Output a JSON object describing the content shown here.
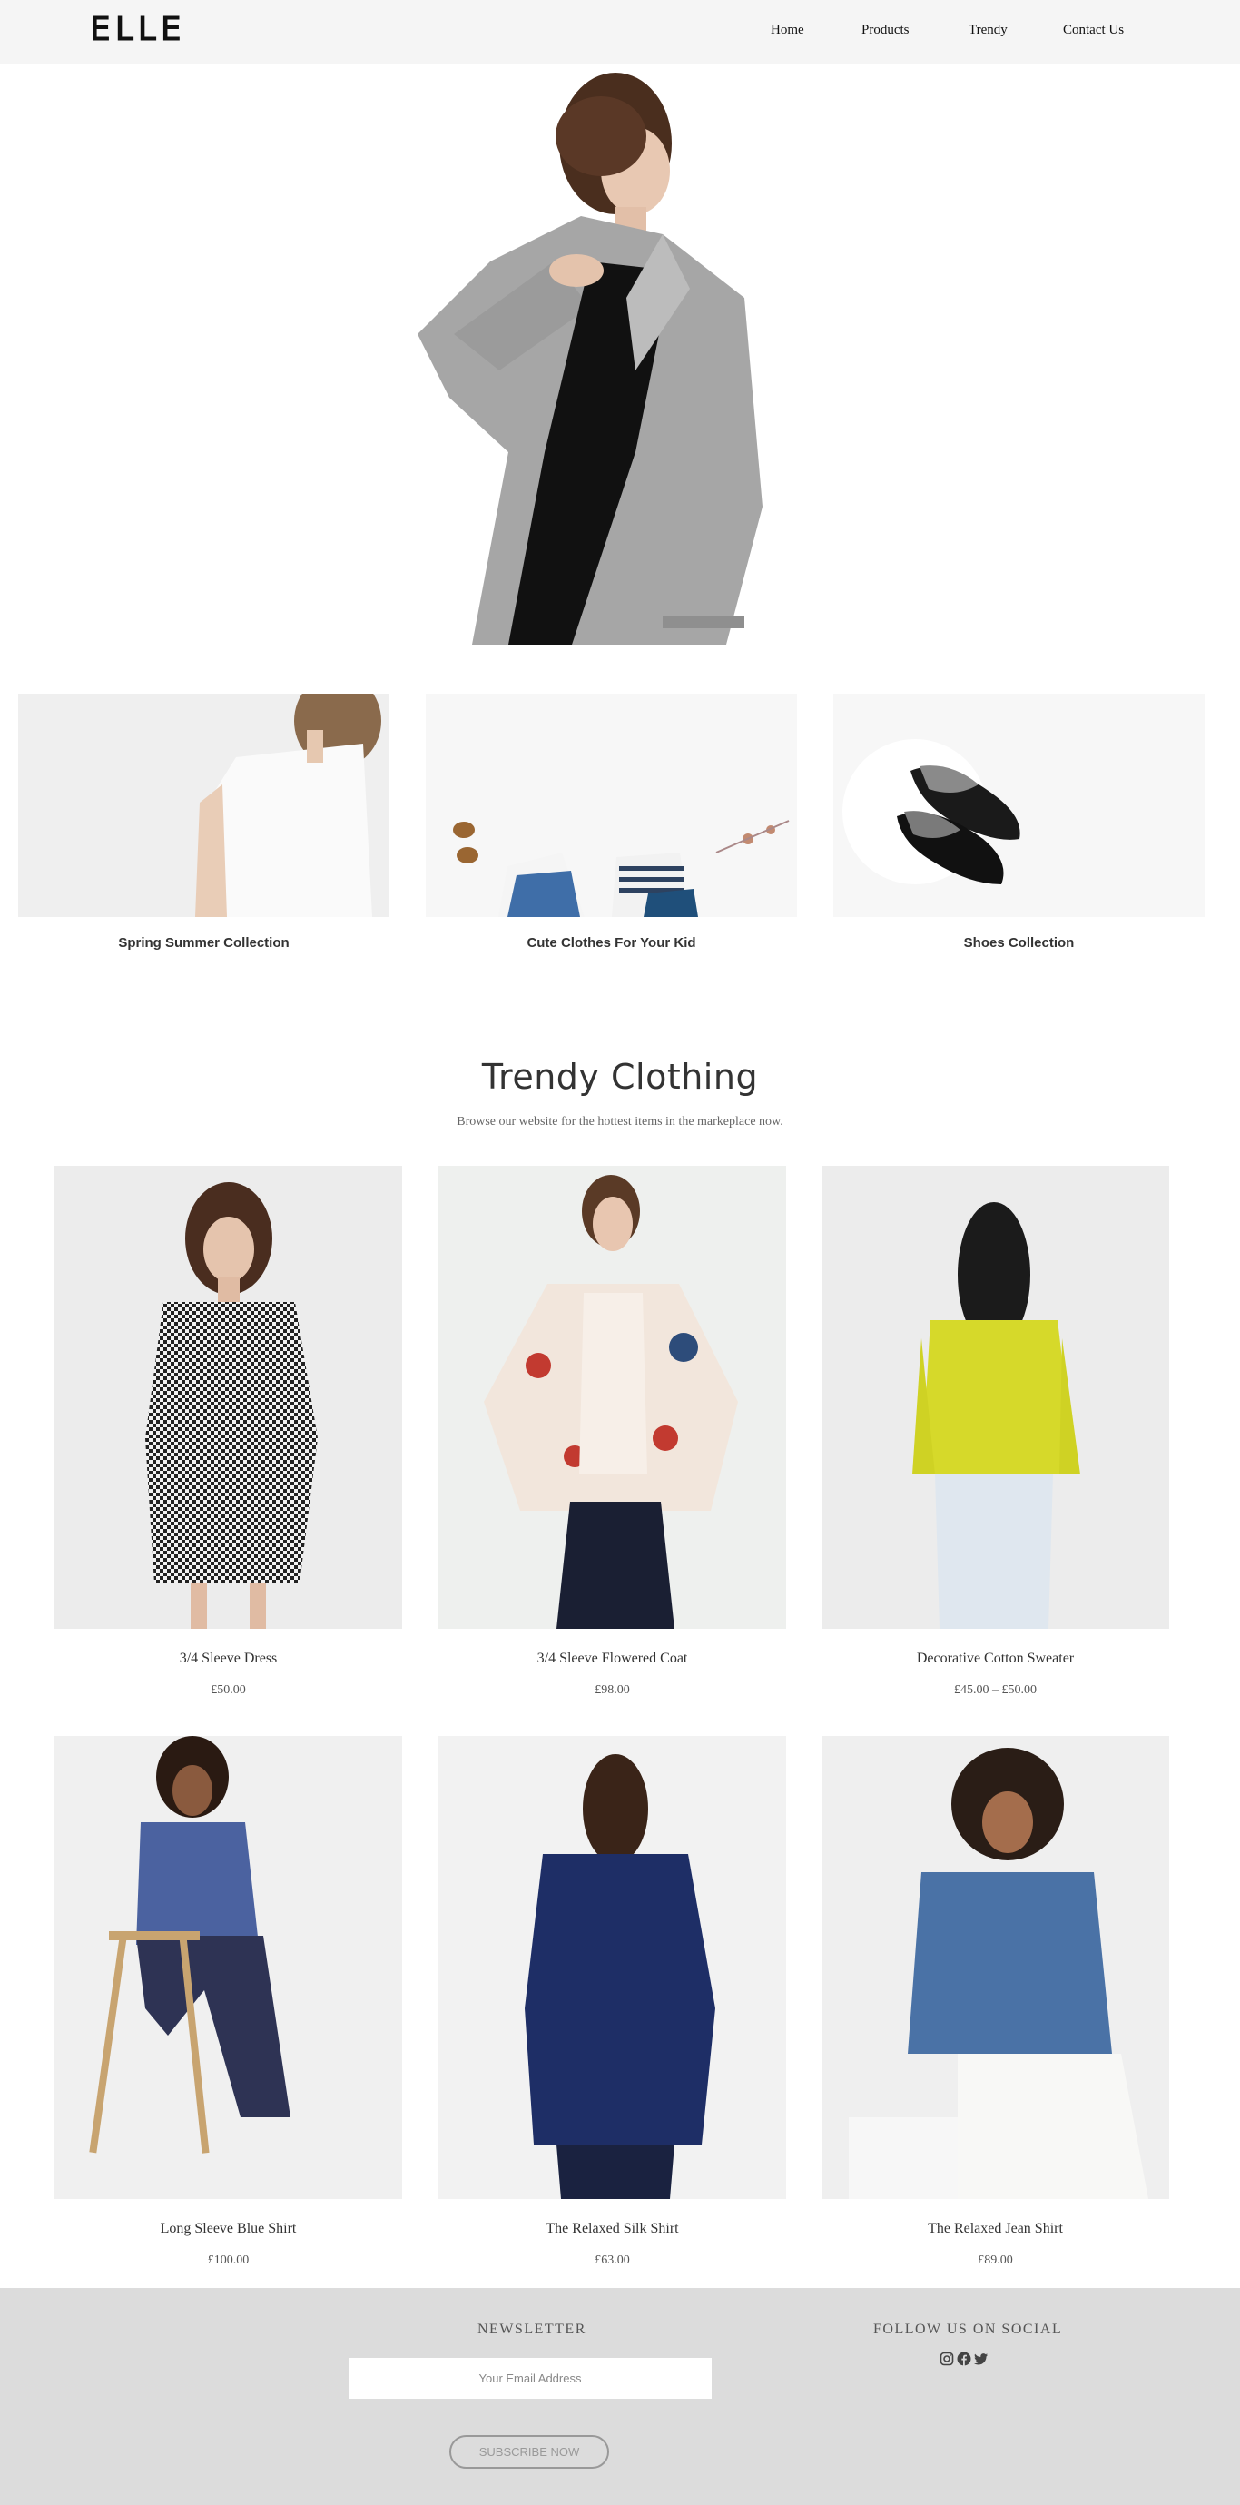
{
  "header": {
    "logo": "ELLE",
    "nav": [
      "Home",
      "Products",
      "Trendy",
      "Contact Us"
    ]
  },
  "categories": [
    {
      "label": "Spring Summer Collection"
    },
    {
      "label": "Cute Clothes For Your Kid"
    },
    {
      "label": "Shoes Collection"
    }
  ],
  "trendy": {
    "title": "Trendy Clothing",
    "subtitle": "Browse our website for the hottest items in the markeplace now."
  },
  "products": [
    {
      "name": "3/4 Sleeve Dress",
      "price": "£50.00"
    },
    {
      "name": "3/4 Sleeve Flowered Coat",
      "price": "£98.00"
    },
    {
      "name": "Decorative Cotton Sweater",
      "price": "£45.00 – £50.00"
    },
    {
      "name": "Long Sleeve Blue Shirt",
      "price": "£100.00"
    },
    {
      "name": "The Relaxed Silk Shirt",
      "price": "£63.00"
    },
    {
      "name": "The Relaxed Jean Shirt",
      "price": "£89.00"
    }
  ],
  "footer": {
    "newsletter_heading": "NEWSLETTER",
    "email_placeholder": "Your Email Address",
    "subscribe_label": "SUBSCRIBE NOW",
    "social_heading": "FOLLOW US ON SOCIAL",
    "social_icons": [
      "instagram-icon",
      "facebook-icon",
      "twitter-icon"
    ]
  },
  "colors": {
    "header_bg": "#f5f5f5",
    "footer_bg": "#dcdcdc",
    "text": "#333333"
  }
}
